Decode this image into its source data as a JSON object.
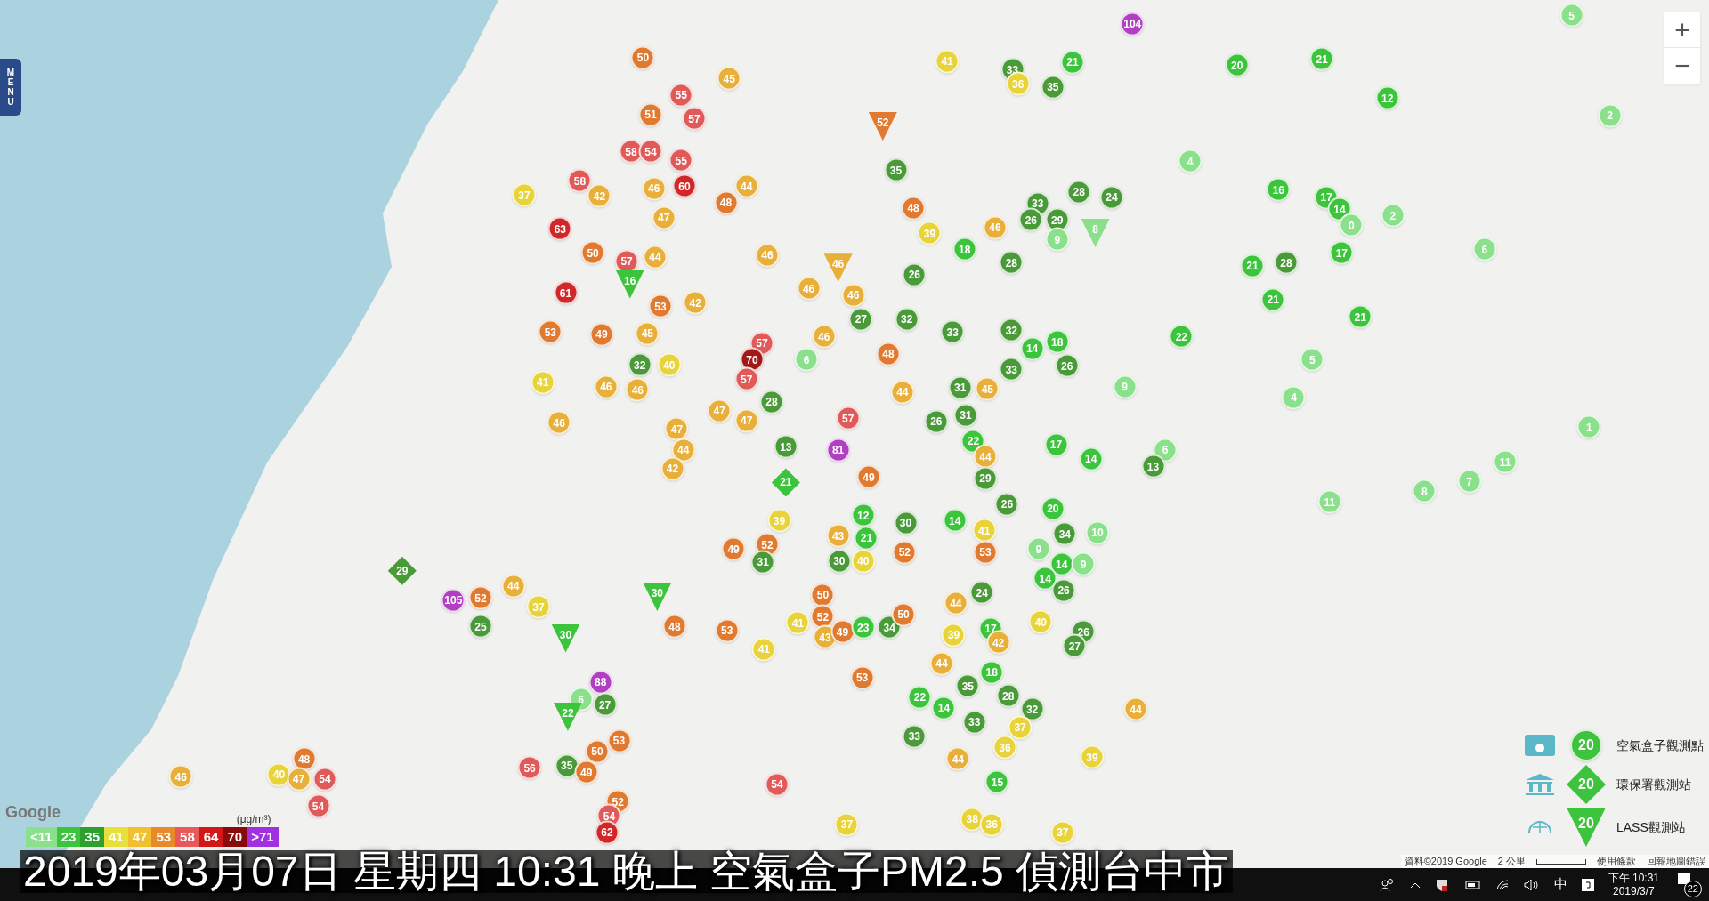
{
  "menu_button": "MENU",
  "zoom": {
    "in": "+",
    "out": "−"
  },
  "markers": [
    {
      "value": "50",
      "color": "#e07a30",
      "kind": "circle"
    },
    {
      "value": "55",
      "color": "#e05a5a",
      "kind": "circle"
    },
    {
      "value": "45",
      "color": "#e8b03a",
      "kind": "circle"
    },
    {
      "value": "57",
      "color": "#e05a5a",
      "kind": "circle"
    },
    {
      "value": "51",
      "color": "#e07a30",
      "kind": "circle"
    },
    {
      "value": "58",
      "color": "#e05a5a",
      "kind": "circle"
    },
    {
      "value": "54",
      "color": "#e05a5a",
      "kind": "circle"
    },
    {
      "value": "55",
      "color": "#e05a5a",
      "kind": "circle"
    },
    {
      "value": "46",
      "color": "#e8b03a",
      "kind": "circle"
    },
    {
      "value": "60",
      "color": "#d02828",
      "kind": "circle"
    },
    {
      "value": "48",
      "color": "#e07a30",
      "kind": "circle"
    },
    {
      "value": "44",
      "color": "#e8b03a",
      "kind": "circle"
    },
    {
      "value": "58",
      "color": "#e05a5a",
      "kind": "circle"
    },
    {
      "value": "37",
      "color": "#e8d43a",
      "kind": "circle"
    },
    {
      "value": "42",
      "color": "#e8b03a",
      "kind": "circle"
    },
    {
      "value": "47",
      "color": "#e8b03a",
      "kind": "circle"
    },
    {
      "value": "63",
      "color": "#d02828",
      "kind": "circle"
    },
    {
      "value": "50",
      "color": "#e07a30",
      "kind": "circle"
    },
    {
      "value": "57",
      "color": "#e05a5a",
      "kind": "circle"
    },
    {
      "value": "44",
      "color": "#e8b03a",
      "kind": "circle"
    },
    {
      "value": "61",
      "color": "#d02828",
      "kind": "circle"
    },
    {
      "value": "16",
      "color": "#3cc43c",
      "kind": "triangle"
    },
    {
      "value": "53",
      "color": "#e07a30",
      "kind": "circle"
    },
    {
      "value": "42",
      "color": "#e8b03a",
      "kind": "circle"
    },
    {
      "value": "53",
      "color": "#e07a30",
      "kind": "circle"
    },
    {
      "value": "49",
      "color": "#e07a30",
      "kind": "circle"
    },
    {
      "value": "45",
      "color": "#e8b03a",
      "kind": "circle"
    },
    {
      "value": "32",
      "color": "#4a9a3a",
      "kind": "circle"
    },
    {
      "value": "40",
      "color": "#e8d43a",
      "kind": "circle"
    },
    {
      "value": "41",
      "color": "#e8d43a",
      "kind": "circle"
    },
    {
      "value": "46",
      "color": "#e8b03a",
      "kind": "circle"
    },
    {
      "value": "46",
      "color": "#e8b03a",
      "kind": "circle"
    },
    {
      "value": "46",
      "color": "#e8b03a",
      "kind": "circle"
    },
    {
      "value": "46",
      "color": "#e8b03a",
      "kind": "circle"
    },
    {
      "value": "46",
      "color": "#e8b03a",
      "kind": "circle"
    },
    {
      "value": "46",
      "color": "#e8b03a",
      "kind": "triangle"
    },
    {
      "value": "57",
      "color": "#e05a5a",
      "kind": "circle"
    },
    {
      "value": "70",
      "color": "#a01818",
      "kind": "circle"
    },
    {
      "value": "57",
      "color": "#e05a5a",
      "kind": "circle"
    },
    {
      "value": "47",
      "color": "#e8b03a",
      "kind": "circle"
    },
    {
      "value": "47",
      "color": "#e8b03a",
      "kind": "circle"
    },
    {
      "value": "47",
      "color": "#e8b03a",
      "kind": "circle"
    },
    {
      "value": "44",
      "color": "#e8b03a",
      "kind": "circle"
    },
    {
      "value": "42",
      "color": "#e8b03a",
      "kind": "circle"
    },
    {
      "value": "28",
      "color": "#4a9a3a",
      "kind": "circle"
    },
    {
      "value": "13",
      "color": "#4a9a3a",
      "kind": "circle"
    },
    {
      "value": "21",
      "color": "#3cc43c",
      "kind": "diamond"
    },
    {
      "value": "57",
      "color": "#e05a5a",
      "kind": "circle"
    },
    {
      "value": "81",
      "color": "#b040c0",
      "kind": "circle"
    },
    {
      "value": "49",
      "color": "#e07a30",
      "kind": "circle"
    },
    {
      "value": "52",
      "color": "#e07a30",
      "kind": "triangle"
    },
    {
      "value": "35",
      "color": "#4a9a3a",
      "kind": "circle"
    },
    {
      "value": "48",
      "color": "#e07a30",
      "kind": "circle"
    },
    {
      "value": "39",
      "color": "#e8d43a",
      "kind": "circle"
    },
    {
      "value": "18",
      "color": "#3cc43c",
      "kind": "circle"
    },
    {
      "value": "46",
      "color": "#e8b03a",
      "kind": "circle"
    },
    {
      "value": "26",
      "color": "#4a9a3a",
      "kind": "circle"
    },
    {
      "value": "46",
      "color": "#e8b03a",
      "kind": "circle"
    },
    {
      "value": "27",
      "color": "#4a9a3a",
      "kind": "circle"
    },
    {
      "value": "32",
      "color": "#4a9a3a",
      "kind": "circle"
    },
    {
      "value": "46",
      "color": "#e8b03a",
      "kind": "circle"
    },
    {
      "value": "48",
      "color": "#e07a30",
      "kind": "circle"
    },
    {
      "value": "6",
      "color": "#8be08b",
      "kind": "circle"
    },
    {
      "value": "33",
      "color": "#4a9a3a",
      "kind": "circle"
    },
    {
      "value": "44",
      "color": "#e8b03a",
      "kind": "circle"
    },
    {
      "value": "31",
      "color": "#4a9a3a",
      "kind": "circle"
    },
    {
      "value": "45",
      "color": "#e8b03a",
      "kind": "circle"
    },
    {
      "value": "26",
      "color": "#4a9a3a",
      "kind": "circle"
    },
    {
      "value": "31",
      "color": "#4a9a3a",
      "kind": "circle"
    },
    {
      "value": "22",
      "color": "#3cc43c",
      "kind": "circle"
    },
    {
      "value": "32",
      "color": "#4a9a3a",
      "kind": "circle"
    },
    {
      "value": "14",
      "color": "#3cc43c",
      "kind": "circle"
    },
    {
      "value": "18",
      "color": "#3cc43c",
      "kind": "circle"
    },
    {
      "value": "26",
      "color": "#4a9a3a",
      "kind": "circle"
    },
    {
      "value": "33",
      "color": "#4a9a3a",
      "kind": "circle"
    },
    {
      "value": "17",
      "color": "#3cc43c",
      "kind": "circle"
    },
    {
      "value": "14",
      "color": "#3cc43c",
      "kind": "circle"
    },
    {
      "value": "6",
      "color": "#8be08b",
      "kind": "circle"
    },
    {
      "value": "13",
      "color": "#4a9a3a",
      "kind": "circle"
    },
    {
      "value": "20",
      "color": "#3cc43c",
      "kind": "circle"
    },
    {
      "value": "34",
      "color": "#4a9a3a",
      "kind": "circle"
    },
    {
      "value": "10",
      "color": "#8be08b",
      "kind": "circle"
    },
    {
      "value": "9",
      "color": "#8be08b",
      "kind": "circle"
    },
    {
      "value": "14",
      "color": "#3cc43c",
      "kind": "circle"
    },
    {
      "value": "9",
      "color": "#8be08b",
      "kind": "circle"
    },
    {
      "value": "26",
      "color": "#4a9a3a",
      "kind": "circle"
    },
    {
      "value": "14",
      "color": "#3cc43c",
      "kind": "circle"
    },
    {
      "value": "40",
      "color": "#e8d43a",
      "kind": "circle"
    },
    {
      "value": "26",
      "color": "#4a9a3a",
      "kind": "circle"
    },
    {
      "value": "27",
      "color": "#4a9a3a",
      "kind": "circle"
    },
    {
      "value": "44",
      "color": "#e8b03a",
      "kind": "circle"
    },
    {
      "value": "29",
      "color": "#4a9a3a",
      "kind": "circle"
    },
    {
      "value": "26",
      "color": "#4a9a3a",
      "kind": "circle"
    },
    {
      "value": "30",
      "color": "#4a9a3a",
      "kind": "circle"
    },
    {
      "value": "21",
      "color": "#3cc43c",
      "kind": "circle"
    },
    {
      "value": "30",
      "color": "#4a9a3a",
      "kind": "circle"
    },
    {
      "value": "40",
      "color": "#e8d43a",
      "kind": "circle"
    },
    {
      "value": "43",
      "color": "#e8b03a",
      "kind": "circle"
    },
    {
      "value": "12",
      "color": "#3cc43c",
      "kind": "circle"
    },
    {
      "value": "50",
      "color": "#e07a30",
      "kind": "circle"
    },
    {
      "value": "52",
      "color": "#e07a30",
      "kind": "circle"
    },
    {
      "value": "41",
      "color": "#e8d43a",
      "kind": "circle"
    },
    {
      "value": "43",
      "color": "#e8b03a",
      "kind": "circle"
    },
    {
      "value": "49",
      "color": "#e07a30",
      "kind": "circle"
    },
    {
      "value": "23",
      "color": "#3cc43c",
      "kind": "circle"
    },
    {
      "value": "34",
      "color": "#4a9a3a",
      "kind": "circle"
    },
    {
      "value": "52",
      "color": "#e07a30",
      "kind": "circle"
    },
    {
      "value": "50",
      "color": "#e07a30",
      "kind": "circle"
    },
    {
      "value": "14",
      "color": "#3cc43c",
      "kind": "circle"
    },
    {
      "value": "41",
      "color": "#e8d43a",
      "kind": "circle"
    },
    {
      "value": "53",
      "color": "#e07a30",
      "kind": "circle"
    },
    {
      "value": "24",
      "color": "#4a9a3a",
      "kind": "circle"
    },
    {
      "value": "44",
      "color": "#e8b03a",
      "kind": "circle"
    },
    {
      "value": "17",
      "color": "#3cc43c",
      "kind": "circle"
    },
    {
      "value": "42",
      "color": "#e8b03a",
      "kind": "circle"
    },
    {
      "value": "39",
      "color": "#e8d43a",
      "kind": "circle"
    },
    {
      "value": "44",
      "color": "#e8b03a",
      "kind": "circle"
    },
    {
      "value": "18",
      "color": "#3cc43c",
      "kind": "circle"
    },
    {
      "value": "35",
      "color": "#4a9a3a",
      "kind": "circle"
    },
    {
      "value": "28",
      "color": "#4a9a3a",
      "kind": "circle"
    },
    {
      "value": "32",
      "color": "#4a9a3a",
      "kind": "circle"
    },
    {
      "value": "22",
      "color": "#3cc43c",
      "kind": "circle"
    },
    {
      "value": "14",
      "color": "#3cc43c",
      "kind": "circle"
    },
    {
      "value": "33",
      "color": "#4a9a3a",
      "kind": "circle"
    },
    {
      "value": "33",
      "color": "#4a9a3a",
      "kind": "circle"
    },
    {
      "value": "37",
      "color": "#e8d43a",
      "kind": "circle"
    },
    {
      "value": "36",
      "color": "#e8d43a",
      "kind": "circle"
    },
    {
      "value": "44",
      "color": "#e8b03a",
      "kind": "circle"
    },
    {
      "value": "15",
      "color": "#3cc43c",
      "kind": "circle"
    },
    {
      "value": "38",
      "color": "#e8d43a",
      "kind": "circle"
    },
    {
      "value": "36",
      "color": "#e8d43a",
      "kind": "circle"
    },
    {
      "value": "37",
      "color": "#e8d43a",
      "kind": "circle"
    },
    {
      "value": "39",
      "color": "#e8d43a",
      "kind": "circle"
    },
    {
      "value": "44",
      "color": "#e8b03a",
      "kind": "circle"
    },
    {
      "value": "53",
      "color": "#e07a30",
      "kind": "circle"
    },
    {
      "value": "54",
      "color": "#e05a5a",
      "kind": "circle"
    },
    {
      "value": "37",
      "color": "#e8d43a",
      "kind": "circle"
    },
    {
      "value": "41",
      "color": "#e8d43a",
      "kind": "circle"
    },
    {
      "value": "39",
      "color": "#e8d43a",
      "kind": "circle"
    },
    {
      "value": "52",
      "color": "#e07a30",
      "kind": "circle"
    },
    {
      "value": "31",
      "color": "#4a9a3a",
      "kind": "circle"
    },
    {
      "value": "49",
      "color": "#e07a30",
      "kind": "circle"
    },
    {
      "value": "53",
      "color": "#e07a30",
      "kind": "circle"
    },
    {
      "value": "48",
      "color": "#e07a30",
      "kind": "circle"
    },
    {
      "value": "30",
      "color": "#3cc43c",
      "kind": "triangle"
    },
    {
      "value": "30",
      "color": "#3cc43c",
      "kind": "triangle"
    },
    {
      "value": "88",
      "color": "#b040c0",
      "kind": "circle"
    },
    {
      "value": "6",
      "color": "#8be08b",
      "kind": "circle"
    },
    {
      "value": "27",
      "color": "#4a9a3a",
      "kind": "circle"
    },
    {
      "value": "22",
      "color": "#3cc43c",
      "kind": "triangle"
    },
    {
      "value": "53",
      "color": "#e07a30",
      "kind": "circle"
    },
    {
      "value": "50",
      "color": "#e07a30",
      "kind": "circle"
    },
    {
      "value": "35",
      "color": "#4a9a3a",
      "kind": "circle"
    },
    {
      "value": "49",
      "color": "#e07a30",
      "kind": "circle"
    },
    {
      "value": "56",
      "color": "#e05a5a",
      "kind": "circle"
    },
    {
      "value": "52",
      "color": "#e07a30",
      "kind": "circle"
    },
    {
      "value": "54",
      "color": "#e05a5a",
      "kind": "circle"
    },
    {
      "value": "62",
      "color": "#d02828",
      "kind": "circle"
    },
    {
      "value": "105",
      "color": "#b040c0",
      "kind": "circle"
    },
    {
      "value": "52",
      "color": "#e07a30",
      "kind": "circle"
    },
    {
      "value": "44",
      "color": "#e8b03a",
      "kind": "circle"
    },
    {
      "value": "37",
      "color": "#e8d43a",
      "kind": "circle"
    },
    {
      "value": "25",
      "color": "#4a9a3a",
      "kind": "circle"
    },
    {
      "value": "29",
      "color": "#4a9a3a",
      "kind": "diamond"
    },
    {
      "value": "46",
      "color": "#e8b03a",
      "kind": "circle"
    },
    {
      "value": "40",
      "color": "#e8d43a",
      "kind": "circle"
    },
    {
      "value": "48",
      "color": "#e07a30",
      "kind": "circle"
    },
    {
      "value": "47",
      "color": "#e8b03a",
      "kind": "circle"
    },
    {
      "value": "54",
      "color": "#e05a5a",
      "kind": "circle"
    },
    {
      "value": "54",
      "color": "#e05a5a",
      "kind": "circle"
    },
    {
      "value": "104",
      "color": "#b040c0",
      "kind": "circle"
    },
    {
      "value": "41",
      "color": "#e8d43a",
      "kind": "circle"
    },
    {
      "value": "33",
      "color": "#4a9a3a",
      "kind": "circle"
    },
    {
      "value": "21",
      "color": "#3cc43c",
      "kind": "circle"
    },
    {
      "value": "36",
      "color": "#e8d43a",
      "kind": "circle"
    },
    {
      "value": "35",
      "color": "#4a9a3a",
      "kind": "circle"
    },
    {
      "value": "20",
      "color": "#3cc43c",
      "kind": "circle"
    },
    {
      "value": "21",
      "color": "#3cc43c",
      "kind": "circle"
    },
    {
      "value": "12",
      "color": "#3cc43c",
      "kind": "circle"
    },
    {
      "value": "5",
      "color": "#8be08b",
      "kind": "circle"
    },
    {
      "value": "2",
      "color": "#8be08b",
      "kind": "circle"
    },
    {
      "value": "4",
      "color": "#8be08b",
      "kind": "circle"
    },
    {
      "value": "16",
      "color": "#3cc43c",
      "kind": "circle"
    },
    {
      "value": "17",
      "color": "#3cc43c",
      "kind": "circle"
    },
    {
      "value": "14",
      "color": "#3cc43c",
      "kind": "circle"
    },
    {
      "value": "0",
      "color": "#8be08b",
      "kind": "circle"
    },
    {
      "value": "2",
      "color": "#8be08b",
      "kind": "circle"
    },
    {
      "value": "17",
      "color": "#3cc43c",
      "kind": "circle"
    },
    {
      "value": "21",
      "color": "#3cc43c",
      "kind": "circle"
    },
    {
      "value": "28",
      "color": "#4a9a3a",
      "kind": "circle"
    },
    {
      "value": "21",
      "color": "#3cc43c",
      "kind": "circle"
    },
    {
      "value": "21",
      "color": "#3cc43c",
      "kind": "circle"
    },
    {
      "value": "6",
      "color": "#8be08b",
      "kind": "circle"
    },
    {
      "value": "22",
      "color": "#3cc43c",
      "kind": "circle"
    },
    {
      "value": "5",
      "color": "#8be08b",
      "kind": "circle"
    },
    {
      "value": "9",
      "color": "#8be08b",
      "kind": "circle"
    },
    {
      "value": "4",
      "color": "#8be08b",
      "kind": "circle"
    },
    {
      "value": "1",
      "color": "#8be08b",
      "kind": "circle"
    },
    {
      "value": "11",
      "color": "#8be08b",
      "kind": "circle"
    },
    {
      "value": "7",
      "color": "#8be08b",
      "kind": "circle"
    },
    {
      "value": "8",
      "color": "#8be08b",
      "kind": "circle"
    },
    {
      "value": "11",
      "color": "#8be08b",
      "kind": "circle"
    },
    {
      "value": "33",
      "color": "#4a9a3a",
      "kind": "circle"
    },
    {
      "value": "28",
      "color": "#4a9a3a",
      "kind": "circle"
    },
    {
      "value": "24",
      "color": "#4a9a3a",
      "kind": "circle"
    },
    {
      "value": "26",
      "color": "#4a9a3a",
      "kind": "circle"
    },
    {
      "value": "29",
      "color": "#4a9a3a",
      "kind": "circle"
    },
    {
      "value": "28",
      "color": "#4a9a3a",
      "kind": "circle"
    },
    {
      "value": "9",
      "color": "#8be08b",
      "kind": "circle"
    },
    {
      "value": "8",
      "color": "#8be08b",
      "kind": "triangle"
    }
  ],
  "scale_legend": {
    "unit": "(μg/m³)",
    "items": [
      {
        "label": "<11",
        "color": "#8be08b"
      },
      {
        "label": "23",
        "color": "#3cc43c"
      },
      {
        "label": "35",
        "color": "#2ea02e"
      },
      {
        "label": "41",
        "color": "#e8e03a"
      },
      {
        "label": "47",
        "color": "#f0c030"
      },
      {
        "label": "53",
        "color": "#e88a2a"
      },
      {
        "label": "58",
        "color": "#e85a5a"
      },
      {
        "label": "64",
        "color": "#d01818"
      },
      {
        "label": "70",
        "color": "#8a0a0a"
      },
      {
        "label": ">71",
        "color": "#a030e0"
      }
    ]
  },
  "station_legend": [
    {
      "kind": "circle",
      "value": "20",
      "label": "空氣盒子觀測點"
    },
    {
      "kind": "diamond",
      "value": "20",
      "label": "環保署觀測站"
    },
    {
      "kind": "triangle",
      "value": "20",
      "label": "LASS觀測站"
    }
  ],
  "map_footer": {
    "brand": "Google",
    "attribution": "資料©2019 Google",
    "scale": "2 公里",
    "terms": "使用條款",
    "report": "回報地圖錯誤"
  },
  "caption": "2019年03月07日 星期四 10:31 晚上 空氣盒子PM2.5 偵測台中市",
  "taskbar": {
    "ime": "中",
    "time": "下午 10:31",
    "date": "2019/3/7",
    "notifications": "22"
  }
}
